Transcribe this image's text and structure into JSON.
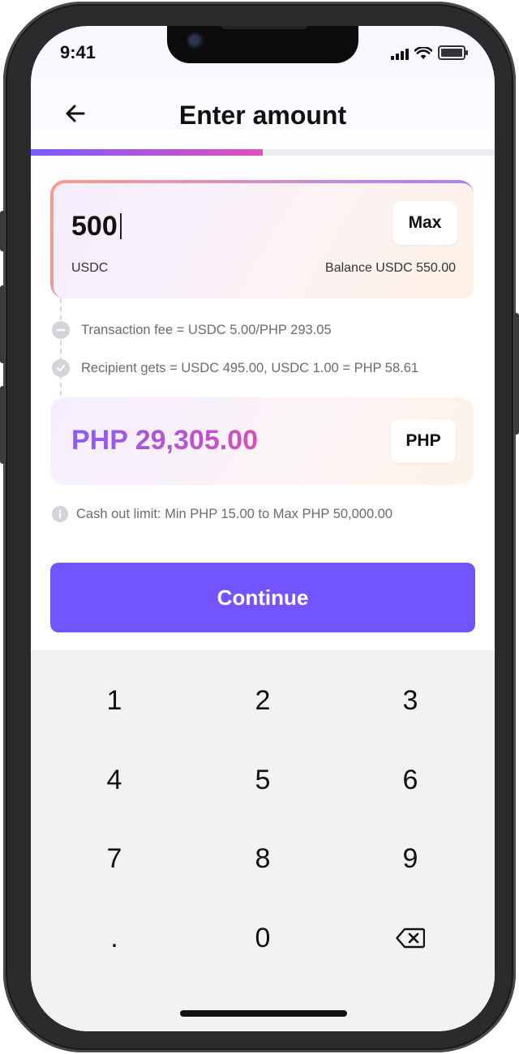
{
  "status_bar": {
    "time": "9:41"
  },
  "header": {
    "title": "Enter amount"
  },
  "progress": {
    "fraction": 0.5
  },
  "amount_card": {
    "value": "500",
    "unit": "USDC",
    "max_label": "Max",
    "balance": "Balance USDC 550.00"
  },
  "fees": [
    {
      "icon": "minus-circle-icon",
      "text": "Transaction fee = USDC 5.00/PHP 293.05"
    },
    {
      "icon": "check-circle-icon",
      "text": "Recipient gets = USDC 495.00, USDC 1.00 = PHP 58.61"
    }
  ],
  "convert_card": {
    "value": "PHP 29,305.00",
    "currency_label": "PHP"
  },
  "limit": {
    "icon": "info-icon",
    "text": "Cash out limit: Min PHP 15.00 to Max PHP 50,000.00"
  },
  "continue_label": "Continue",
  "keypad": {
    "keys": [
      "1",
      "2",
      "3",
      "4",
      "5",
      "6",
      "7",
      "8",
      "9",
      ".",
      "0"
    ],
    "backspace_icon": "backspace-icon"
  },
  "colors": {
    "accent": "#7355ff",
    "gradient_start": "#8a5cf2",
    "gradient_end": "#d84eb6"
  }
}
